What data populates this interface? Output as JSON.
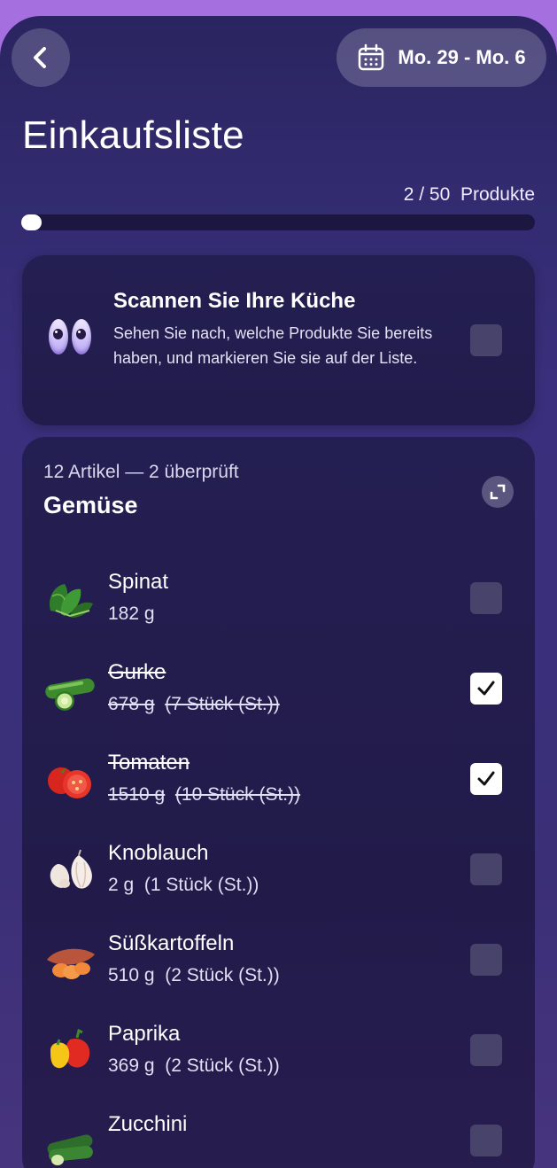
{
  "header": {
    "back_icon": "chevron-left-icon",
    "calendar_icon": "calendar-icon",
    "date_range": "Mo. 29 - Mo. 6"
  },
  "title": "Einkaufsliste",
  "progress": {
    "label": "2 / 50  Produkte",
    "checked": 2,
    "total": 50
  },
  "scan_card": {
    "icon": "eyes-icon",
    "title": "Scannen Sie Ihre Küche",
    "description": "Sehen Sie nach, welche Produkte Sie bereits haben, und markieren Sie sie auf der Liste.",
    "checked": false
  },
  "category": {
    "meta": "12 Artikel — 2 überprüft",
    "title": "Gemüse",
    "expand_icon": "expand-icon",
    "items": [
      {
        "name": "Spinat",
        "weight": "182 g",
        "count": "",
        "checked": false,
        "icon": "spinach-icon"
      },
      {
        "name": "Gurke",
        "weight": "678 g",
        "count": "(7 Stück (St.))",
        "checked": true,
        "icon": "cucumber-icon"
      },
      {
        "name": "Tomaten",
        "weight": "1510 g",
        "count": "(10 Stück (St.))",
        "checked": true,
        "icon": "tomato-icon"
      },
      {
        "name": "Knoblauch",
        "weight": "2 g",
        "count": "(1 Stück (St.))",
        "checked": false,
        "icon": "garlic-icon"
      },
      {
        "name": "Süßkartoffeln",
        "weight": "510 g",
        "count": "(2 Stück (St.))",
        "checked": false,
        "icon": "sweet-potato-icon"
      },
      {
        "name": "Paprika",
        "weight": "369 g",
        "count": "(2 Stück (St.))",
        "checked": false,
        "icon": "bell-pepper-icon"
      },
      {
        "name": "Zucchini",
        "weight": "",
        "count": "",
        "checked": false,
        "icon": "zucchini-icon"
      }
    ]
  }
}
